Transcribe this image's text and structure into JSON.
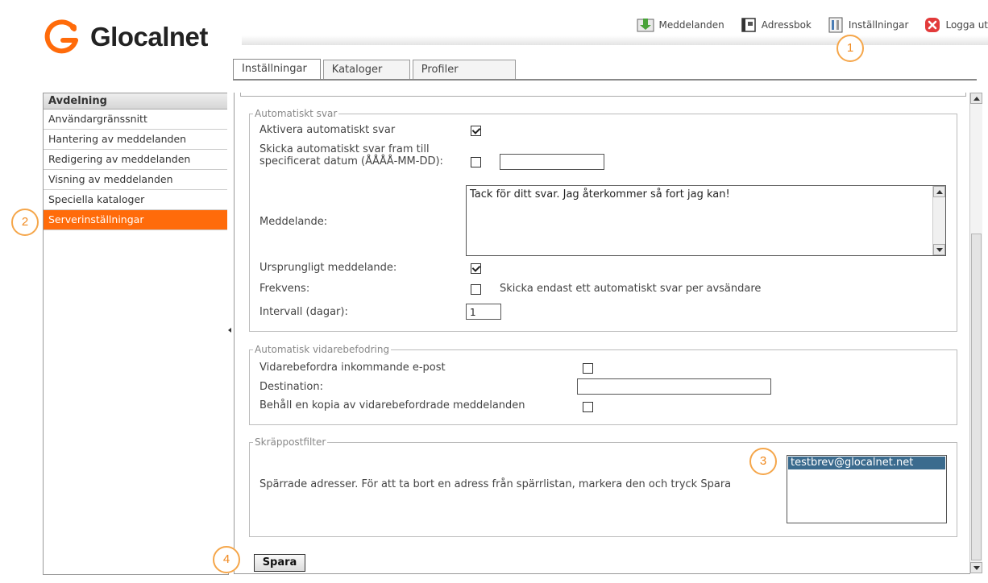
{
  "brand": {
    "name": "Glocalnet",
    "accent": "#ff6b0a"
  },
  "topnav": {
    "messages": "Meddelanden",
    "addressbook": "Adressbok",
    "settings": "Inställningar",
    "logout": "Logga ut"
  },
  "tabs": [
    "Inställningar",
    "Kataloger",
    "Profiler"
  ],
  "sidebar": {
    "heading": "Avdelning",
    "items": [
      "Användargränssnitt",
      "Hantering av meddelanden",
      "Redigering av meddelanden",
      "Visning av meddelanden",
      "Speciella kataloger",
      "Serverinställningar"
    ],
    "active": "Serverinställningar"
  },
  "autoreply": {
    "legend": "Automatiskt svar",
    "activate_label": "Aktivera automatiskt svar",
    "activate_checked": true,
    "until_label": "Skicka automatiskt svar fram till specificerat datum (ÅÅÅÅ-MM-DD):",
    "until_checked": false,
    "until_value": "",
    "message_label": "Meddelande:",
    "message_value": "Tack för ditt svar. Jag återkommer så fort jag kan!",
    "original_label": "Ursprungligt meddelande:",
    "original_checked": true,
    "frequency_label": "Frekvens:",
    "frequency_checked": false,
    "frequency_text": "Skicka endast ett automatiskt svar per avsändare",
    "interval_label": "Intervall (dagar):",
    "interval_value": "1"
  },
  "forwarding": {
    "legend": "Automatisk vidarebefodring",
    "forward_label": "Vidarebefordra inkommande e-post",
    "forward_checked": false,
    "destination_label": "Destination:",
    "destination_value": "",
    "keep_copy_label": "Behåll en kopia av vidarebefordrade meddelanden",
    "keep_copy_checked": false
  },
  "spam": {
    "legend": "Skräppostfilter",
    "blocked_label": "Spärrade adresser. För att ta bort en adress från spärrlistan, markera den och tryck Spara",
    "blocked": [
      "testbrev@glocalnet.net"
    ]
  },
  "save_label": "Spara",
  "callouts": [
    "1",
    "2",
    "3",
    "4"
  ]
}
